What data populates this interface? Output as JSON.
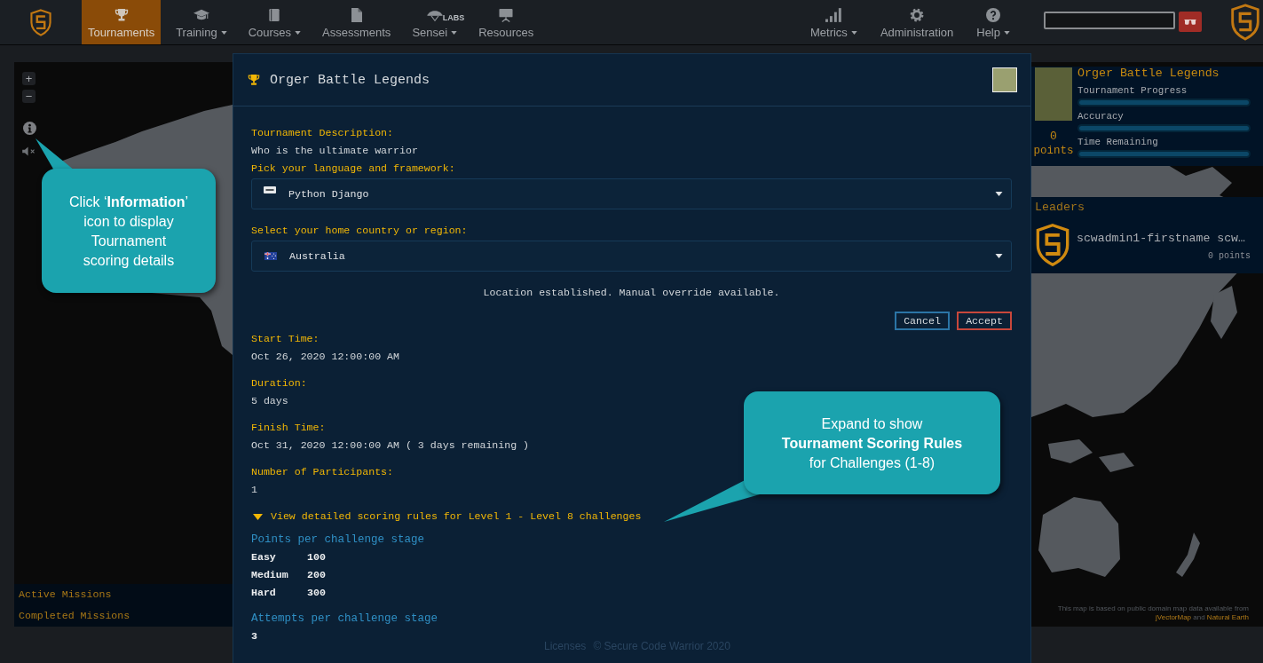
{
  "nav": {
    "left_items": [
      {
        "label": "Tournaments",
        "selected": true,
        "dropdown": false
      },
      {
        "label": "Training",
        "selected": false,
        "dropdown": true
      },
      {
        "label": "Courses",
        "selected": false,
        "dropdown": true
      },
      {
        "label": "Assessments",
        "selected": false,
        "dropdown": false
      },
      {
        "label": "Sensei",
        "selected": false,
        "dropdown": true,
        "badge": "LABS"
      },
      {
        "label": "Resources",
        "selected": false,
        "dropdown": false
      }
    ],
    "right_items": [
      {
        "label": "Metrics",
        "selected": false,
        "dropdown": true
      },
      {
        "label": "Administration",
        "selected": false,
        "dropdown": false
      },
      {
        "label": "Help",
        "selected": false,
        "dropdown": true
      }
    ]
  },
  "map": {
    "zoom_buttons": [
      "+",
      "−"
    ],
    "missions": [
      "Active Missions",
      "Completed Missions"
    ],
    "attribution": [
      {
        "kind": "text",
        "text": "This map is based on public domain map data available from "
      },
      {
        "kind": "link",
        "text": "jVectorMap"
      },
      {
        "kind": "text",
        "text": " and "
      },
      {
        "kind": "link",
        "text": "Natural Earth"
      }
    ]
  },
  "tournament_card": {
    "title": "Orger Battle Legends",
    "points": "0",
    "points_label": "points",
    "meters": [
      {
        "label": "Tournament Progress",
        "level": 1
      },
      {
        "label": "Accuracy",
        "level": 1
      },
      {
        "label": "Time Remaining",
        "level": 1
      }
    ]
  },
  "leaders": {
    "title": "Leaders",
    "entries": [
      {
        "name": "scwadmin1-firstname scw…",
        "points": "0 points"
      }
    ]
  },
  "modal": {
    "title": "Orger Battle Legends",
    "fields": [
      {
        "kind": "text",
        "label": "Tournament Description:",
        "value": "Who is the ultimate warrior"
      },
      {
        "kind": "select",
        "label": "Pick your language and framework:",
        "value": "Python Django"
      },
      {
        "kind": "select",
        "label": "Select your home country or region:",
        "value": "Australia"
      }
    ],
    "notice": "Location established. Manual override available.",
    "buttons": [
      {
        "kind": "cancel",
        "label": "Cancel"
      },
      {
        "kind": "accept",
        "label": "Accept"
      }
    ],
    "details": [
      {
        "label": "Start Time:",
        "value": "Oct 26, 2020 12:00:00 AM"
      },
      {
        "label": "Duration:",
        "value": "5 days"
      },
      {
        "label": "Finish Time:",
        "value": "Oct 31, 2020 12:00:00 AM ( 3 days remaining )"
      },
      {
        "label": "Number of Participants:",
        "value": "1"
      }
    ],
    "scoring": {
      "toggle": "View detailed scoring rules for Level 1 - Level 8 challenges",
      "expanded": true,
      "sections": [
        {
          "title": "Points per challenge stage",
          "rows": [
            [
              "Easy",
              "100"
            ],
            [
              "Medium",
              "200"
            ],
            [
              "Hard",
              "300"
            ]
          ]
        },
        {
          "title": "Attempts per challenge stage",
          "rows": [
            [
              "3"
            ]
          ]
        }
      ]
    }
  },
  "footer": {
    "link": "Licenses",
    "copyright": "© Secure Code Warrior 2020"
  },
  "callouts": [
    {
      "lines": [
        "Click ‘**Information**’",
        "icon to display",
        "Tournament",
        "scoring details"
      ]
    },
    {
      "lines": [
        "Expand to show",
        "**Tournament Scoring Rules**",
        "for Challenges (1-8)"
      ]
    }
  ]
}
